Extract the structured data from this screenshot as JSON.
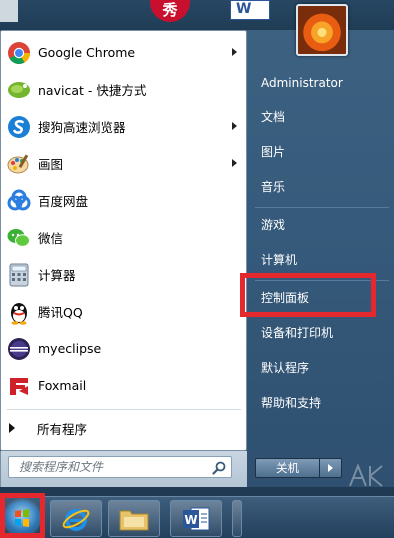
{
  "desktop": {
    "icon_b_text": "秀",
    "icon_c_text": "W"
  },
  "programs": [
    {
      "label": "Google Chrome",
      "icon": "chrome-icon",
      "submenu": true
    },
    {
      "label": "navicat - 快捷方式",
      "icon": "navicat-icon",
      "submenu": false
    },
    {
      "label": "搜狗高速浏览器",
      "icon": "sogou-browser-icon",
      "submenu": true
    },
    {
      "label": "画图",
      "icon": "paint-icon",
      "submenu": true
    },
    {
      "label": "百度网盘",
      "icon": "baidu-netdisk-icon",
      "submenu": false
    },
    {
      "label": "微信",
      "icon": "wechat-icon",
      "submenu": false
    },
    {
      "label": "计算器",
      "icon": "calculator-icon",
      "submenu": false
    },
    {
      "label": "腾讯QQ",
      "icon": "qq-icon",
      "submenu": false
    },
    {
      "label": "myeclipse",
      "icon": "myeclipse-icon",
      "submenu": false
    },
    {
      "label": "Foxmail",
      "icon": "foxmail-icon",
      "submenu": false
    }
  ],
  "all_programs_label": "所有程序",
  "search": {
    "placeholder": "搜索程序和文件"
  },
  "right_pane": {
    "user_name": "Administrator",
    "items": [
      "文档",
      "图片",
      "音乐",
      "游戏",
      "计算机",
      "控制面板",
      "设备和打印机",
      "默认程序",
      "帮助和支持"
    ]
  },
  "shutdown_label": "关机",
  "taskbar": {
    "word_label": "W"
  },
  "colors": {
    "highlight": "#e4282d",
    "right_pane": "#35597a",
    "taskbar": "#2e4c6a"
  }
}
